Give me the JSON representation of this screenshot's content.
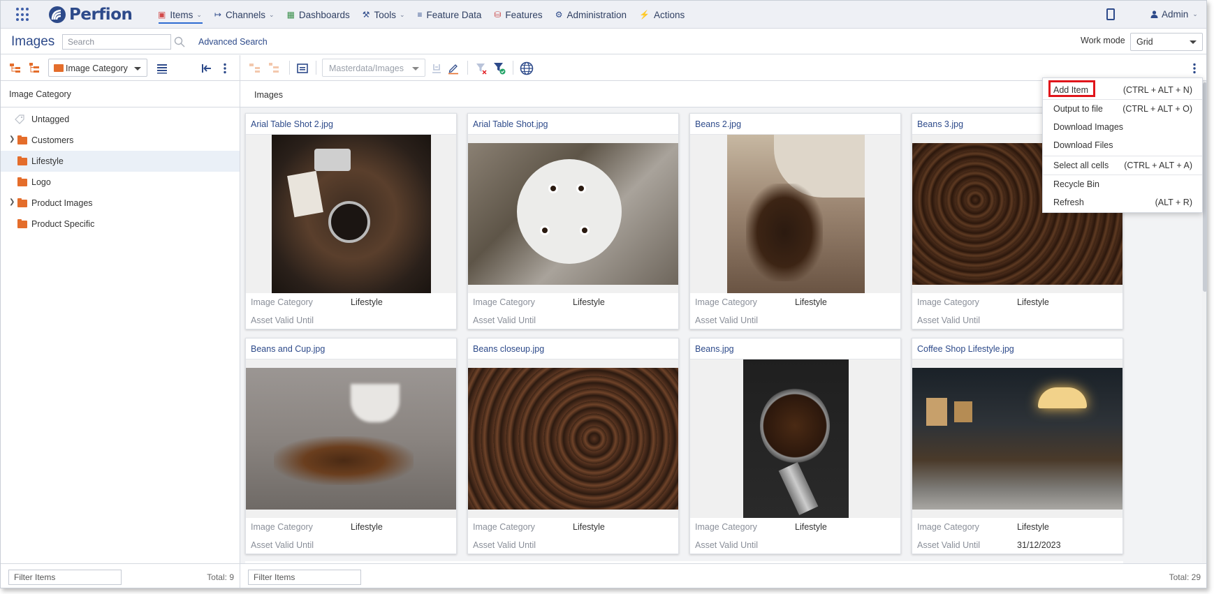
{
  "app": {
    "brand": "Perfion",
    "nav": [
      {
        "label": "Items",
        "icon": "cube-icon",
        "dropdown": true,
        "active": true
      },
      {
        "label": "Channels",
        "icon": "channels-icon",
        "dropdown": true
      },
      {
        "label": "Dashboards",
        "icon": "dashboard-icon",
        "dropdown": false
      },
      {
        "label": "Tools",
        "icon": "wrench-icon",
        "dropdown": true
      },
      {
        "label": "Feature Data",
        "icon": "list-icon",
        "dropdown": false
      },
      {
        "label": "Features",
        "icon": "database-icon",
        "dropdown": false
      },
      {
        "label": "Administration",
        "icon": "gear-icon",
        "dropdown": false
      },
      {
        "label": "Actions",
        "icon": "lightning-icon",
        "dropdown": false
      }
    ],
    "user": "Admin"
  },
  "pagebar": {
    "title": "Images",
    "search_placeholder": "Search",
    "advanced_search": "Advanced Search",
    "workmode_label": "Work mode",
    "workmode_value": "Grid"
  },
  "left_toolbar": {
    "category_select": "Image Category"
  },
  "right_toolbar": {
    "view_select": "Masterdata/Images"
  },
  "tree": {
    "header": "Image Category",
    "items": [
      {
        "label": "Untagged",
        "type": "tag"
      },
      {
        "label": "Customers",
        "type": "folder",
        "expandable": true
      },
      {
        "label": "Lifestyle",
        "type": "folder",
        "selected": true
      },
      {
        "label": "Logo",
        "type": "folder"
      },
      {
        "label": "Product Images",
        "type": "folder",
        "expandable": true
      },
      {
        "label": "Product Specific",
        "type": "folder"
      }
    ]
  },
  "grid": {
    "header": "Images",
    "field_labels": {
      "category": "Image Category",
      "valid_until": "Asset Valid Until"
    },
    "cards": [
      {
        "title": "Arial Table Shot 2.jpg",
        "category": "Lifestyle",
        "valid_until": ""
      },
      {
        "title": "Arial Table Shot.jpg",
        "category": "Lifestyle",
        "valid_until": ""
      },
      {
        "title": "Beans 2.jpg",
        "category": "Lifestyle",
        "valid_until": ""
      },
      {
        "title": "Beans 3.jpg",
        "category": "Lifestyle",
        "valid_until": ""
      },
      {
        "title": "Beans and Cup.jpg",
        "category": "Lifestyle",
        "valid_until": ""
      },
      {
        "title": "Beans closeup.jpg",
        "category": "Lifestyle",
        "valid_until": ""
      },
      {
        "title": "Beans.jpg",
        "category": "Lifestyle",
        "valid_until": ""
      },
      {
        "title": "Coffee Shop Lifestyle.jpg",
        "category": "Lifestyle",
        "valid_until": "31/12/2023"
      }
    ]
  },
  "left_footer": {
    "filter_placeholder": "Filter Items",
    "total": "Total: 9"
  },
  "right_footer": {
    "filter_placeholder": "Filter Items",
    "total": "Total: 29"
  },
  "context_menu": {
    "items": [
      {
        "label": "Add Item",
        "shortcut": "(CTRL + ALT + N)",
        "highlighted": true
      },
      {
        "label": "Output to file",
        "shortcut": "(CTRL + ALT + O)"
      },
      {
        "label": "Download Images",
        "shortcut": ""
      },
      {
        "label": "Download Files",
        "shortcut": ""
      },
      {
        "label": "Select all cells",
        "shortcut": "(CTRL + ALT + A)"
      },
      {
        "label": "Recycle Bin",
        "shortcut": ""
      },
      {
        "label": "Refresh",
        "shortcut": "(ALT + R)"
      }
    ]
  },
  "colors": {
    "brand": "#2d4a8a",
    "folder": "#e46d2b",
    "highlight_box": "#e0151b",
    "accent": "#2d6bd1"
  }
}
